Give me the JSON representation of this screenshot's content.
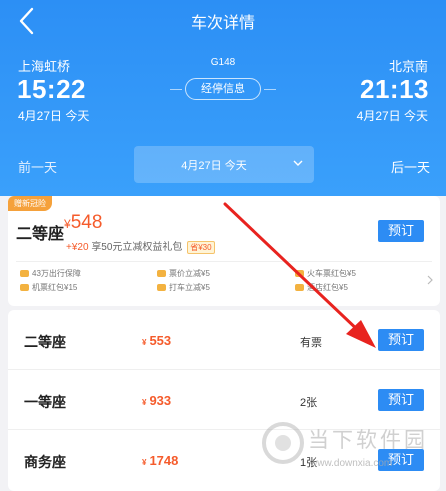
{
  "header": {
    "title": "车次详情",
    "train_no": "G148",
    "stops_label": "经停信息",
    "departure": {
      "station": "上海虹桥",
      "time": "15:22",
      "date": "4月27日 今天"
    },
    "arrival": {
      "station": "北京南",
      "time": "21:13",
      "date": "4月27日 今天"
    },
    "prev_day": "前一天",
    "next_day": "后一天",
    "selected_date": "4月27日 今天"
  },
  "featured": {
    "badge": "赠新冠险",
    "seat": "二等座",
    "currency": "¥",
    "price": "548",
    "extra_plus": "+¥20",
    "extra_text": "享50元立减权益礼包",
    "save_tag": "省¥30",
    "book_label": "预订",
    "benefits": [
      "43万出行保障",
      "票价立减¥5",
      "火车票红包¥5",
      "机票红包¥15",
      "打车立减¥5",
      "酒店红包¥5"
    ]
  },
  "seats": [
    {
      "name": "二等座",
      "currency": "¥",
      "price": "553",
      "availability": "有票",
      "book_label": "预订"
    },
    {
      "name": "一等座",
      "currency": "¥",
      "price": "933",
      "availability": "2张",
      "book_label": "预订"
    },
    {
      "name": "商务座",
      "currency": "¥",
      "price": "1748",
      "availability": "1张",
      "book_label": "预订"
    }
  ],
  "watermark": {
    "title": "当下软件园",
    "url": "www.downxia.com"
  },
  "colors": {
    "brand_blue": "#2d8cf4",
    "price_orange": "#f55b2b",
    "annotation_red": "#e8231f",
    "badge_orange": "#f5a13b"
  }
}
